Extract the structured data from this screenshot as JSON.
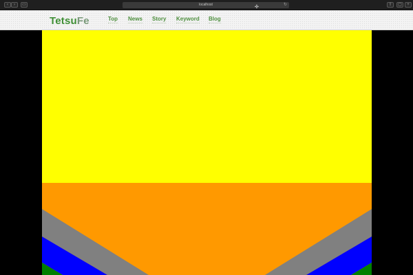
{
  "browser": {
    "address": "localhost"
  },
  "site": {
    "logo_part1": "Tetsu",
    "logo_part2": "Fe",
    "nav": [
      "Top",
      "News",
      "Story",
      "Keyword",
      "Blog"
    ]
  },
  "colors": {
    "upper_band": "#ffff00",
    "lower_band": "#ff9900",
    "stripe_1": "#808080",
    "stripe_2": "#0000ff",
    "stripe_3": "#007f00",
    "side_margins": "#000000"
  }
}
